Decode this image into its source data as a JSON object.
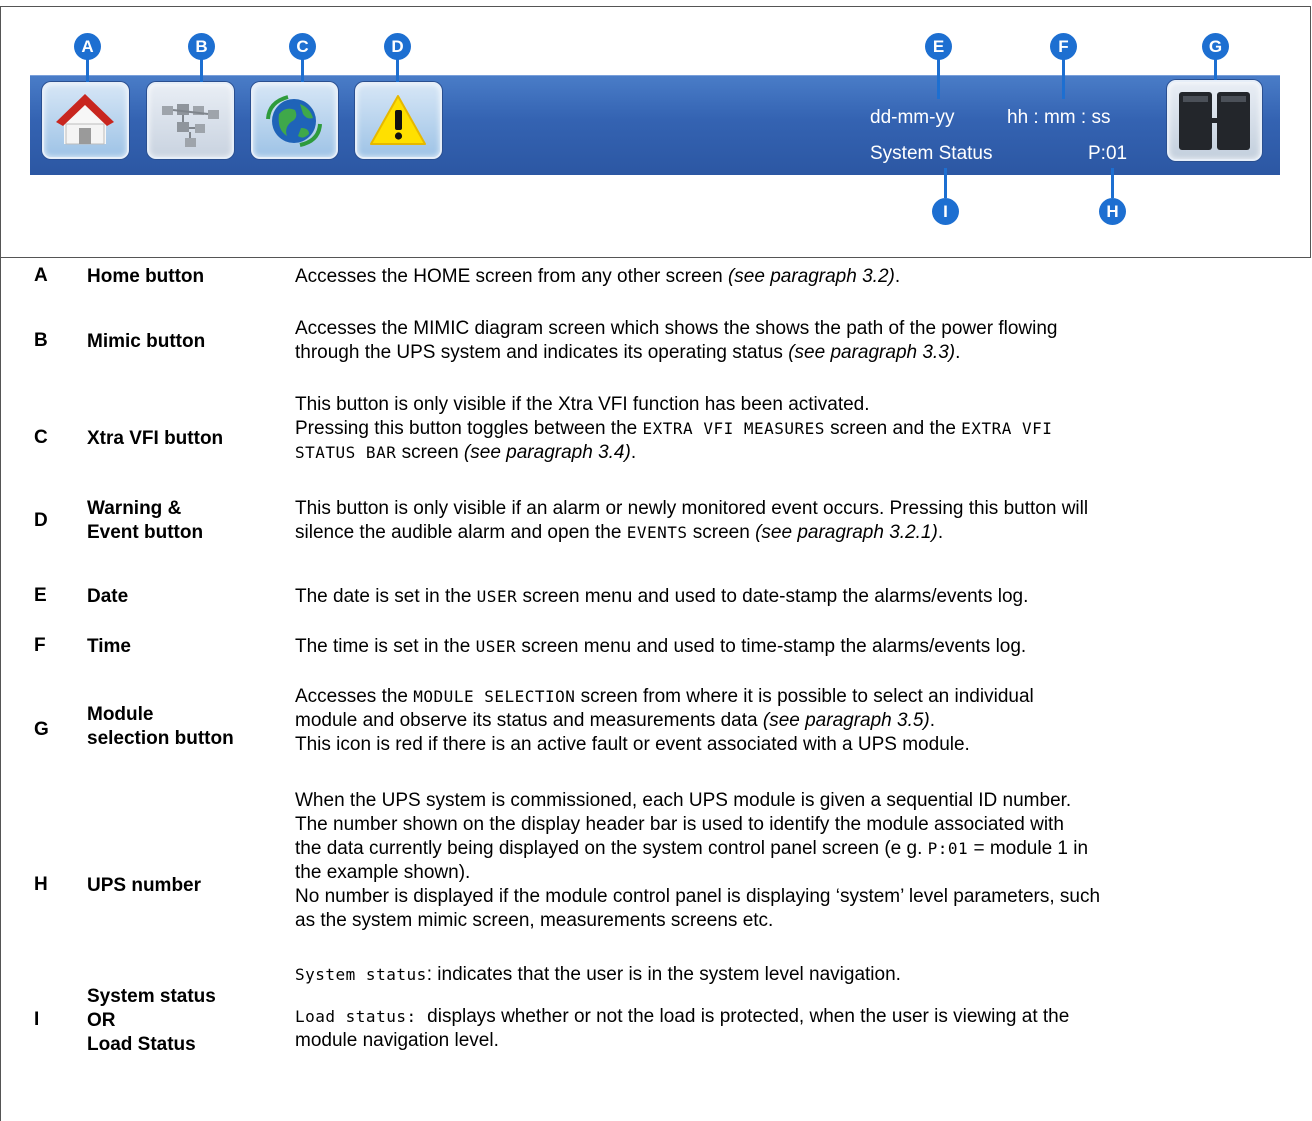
{
  "header": {
    "date": "dd-mm-yy",
    "time": "hh : mm : ss",
    "status": "System Status",
    "ups_number": "P:01"
  },
  "markers": {
    "A": "A",
    "B": "B",
    "C": "C",
    "D": "D",
    "E": "E",
    "F": "F",
    "G": "G",
    "H": "H",
    "I": "I"
  },
  "icons": {
    "home": "home-icon",
    "mimic": "mimic-diagram-icon",
    "xtra_vfi": "globe-icon",
    "warning": "warning-icon",
    "module": "module-selection-icon"
  },
  "colors": {
    "header_bar": "#3463b2",
    "marker": "#1d6fd1"
  },
  "rows": {
    "A": {
      "letter": "A",
      "name": "Home button",
      "desc": "Accesses the HOME screen from any other screen ",
      "ref": "(see paragraph 3.2)",
      "end": "."
    },
    "B": {
      "letter": "B",
      "name": "Mimic button",
      "desc1": "Accesses the MIMIC diagram screen which shows the shows the path of the power flowing",
      "desc2": "through the UPS system and indicates its operating status ",
      "ref": "(see paragraph 3.3)",
      "end": "."
    },
    "C": {
      "letter": "C",
      "name": "Xtra VFI button",
      "desc1": "This button is only visible if the Xtra VFI function has been activated.",
      "desc2_pre": "Pressing this button toggles between the ",
      "mono1": "EXTRA VFI MEASURES",
      "desc2_mid": " screen and the ",
      "mono2a": "EXTRA VFI",
      "mono2b": "STATUS BAR",
      "desc3_mid": " screen ",
      "ref": "(see paragraph 3.4)",
      "end": "."
    },
    "D": {
      "letter": "D",
      "name1": "Warning &",
      "name2": "Event button",
      "desc1": "This button is only visible if an alarm or newly monitored event occurs. Pressing this button will",
      "desc2_pre": "silence the audible alarm and open the ",
      "mono": "EVENTS",
      "desc2_mid": " screen ",
      "ref": "(see paragraph 3.2.1)",
      "end": "."
    },
    "E": {
      "letter": "E",
      "name": "Date",
      "pre": "The date is set in the ",
      "mono": "USER",
      "post": " screen menu and used to date-stamp the alarms/events log."
    },
    "F": {
      "letter": "F",
      "name": "Time",
      "pre": "The time is set in the ",
      "mono": "USER",
      "post": " screen menu and used to time-stamp the alarms/events log."
    },
    "G": {
      "letter": "G",
      "name1": "Module",
      "name2": "selection button",
      "desc1_pre": "Accesses the ",
      "mono": "MODULE SELECTION",
      "desc1_post": " screen from where it is possible to select an individual",
      "desc2": "module and observe its status and measurements data ",
      "ref": "(see paragraph 3.5)",
      "end": ".",
      "desc3": "This icon is red if there is an active fault or event associated with a UPS module."
    },
    "H": {
      "letter": "H",
      "name": "UPS number",
      "l1": "When the UPS system is commissioned, each UPS module is given a sequential ID number.",
      "l2": "The number shown on the display header bar is used to identify the module associated with",
      "l3": "the data currently being displayed on the system control panel screen (e g. ",
      "mono": "P:01",
      "l3_post": " = module 1 in",
      "l4": "the example shown).",
      "l5": "No number is displayed if the module control panel is displaying ‘system’ level parameters, such",
      "l6": "as the system mimic screen, measurements screens etc."
    },
    "I": {
      "letter": "I",
      "name1": "System status",
      "name2": "OR",
      "name3": "Load Status",
      "mono1": "System status",
      "d1": ": indicates that the user is in the system level navigation.",
      "mono2": "Load status:",
      "d2": "  displays whether or not the load is protected, when the user is viewing at the",
      "d3": "module navigation level."
    }
  }
}
